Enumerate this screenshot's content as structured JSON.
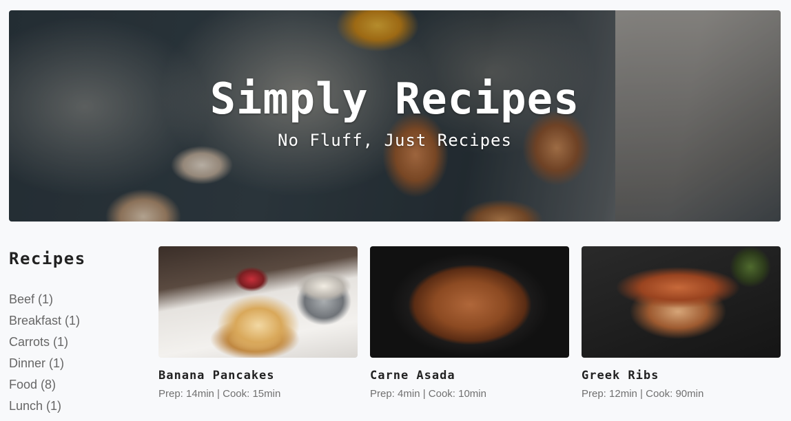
{
  "hero": {
    "title": "Simply Recipes",
    "subtitle": "No Fluff, Just Recipes"
  },
  "sidebar": {
    "title": "Recipes",
    "tags": [
      {
        "label": "Beef (1)"
      },
      {
        "label": "Breakfast (1)"
      },
      {
        "label": "Carrots (1)"
      },
      {
        "label": "Dinner (1)"
      },
      {
        "label": "Food (8)"
      },
      {
        "label": "Lunch (1)"
      }
    ]
  },
  "recipes": [
    {
      "title": "Banana Pancakes",
      "meta": "Prep: 14min | Cook: 15min",
      "image": "pancakes-photo"
    },
    {
      "title": "Carne Asada",
      "meta": "Prep: 4min | Cook: 10min",
      "image": "carne-asada-photo"
    },
    {
      "title": "Greek Ribs",
      "meta": "Prep: 12min | Cook: 90min",
      "image": "greek-ribs-photo"
    }
  ],
  "colors": {
    "background": "#f8f9fb",
    "text": "#222222",
    "muted_text": "#707070"
  }
}
